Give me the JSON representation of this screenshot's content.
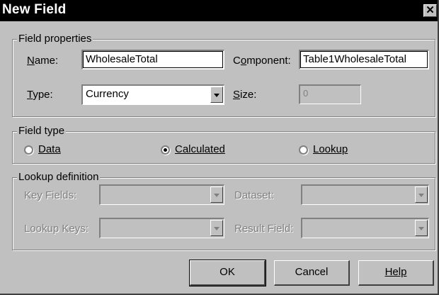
{
  "dialog": {
    "title": "New Field",
    "close_label": "✕"
  },
  "field_properties": {
    "legend": "Field properties",
    "name_label": "Name:",
    "name_value": "WholesaleTotal",
    "component_label": "Component:",
    "component_value": "Table1WholesaleTotal",
    "type_label": "Type:",
    "type_value": "Currency",
    "size_label": "Size:",
    "size_value": "0"
  },
  "field_type": {
    "legend": "Field type",
    "options": [
      {
        "label": "Data",
        "selected": false
      },
      {
        "label": "Calculated",
        "selected": true
      },
      {
        "label": "Lookup",
        "selected": false
      }
    ]
  },
  "lookup_definition": {
    "legend": "Lookup definition",
    "key_fields_label": "Key Fields:",
    "dataset_label": "Dataset:",
    "lookup_keys_label": "Lookup Keys:",
    "result_field_label": "Result Field:"
  },
  "buttons": {
    "ok": "OK",
    "cancel": "Cancel",
    "help": "Help"
  }
}
